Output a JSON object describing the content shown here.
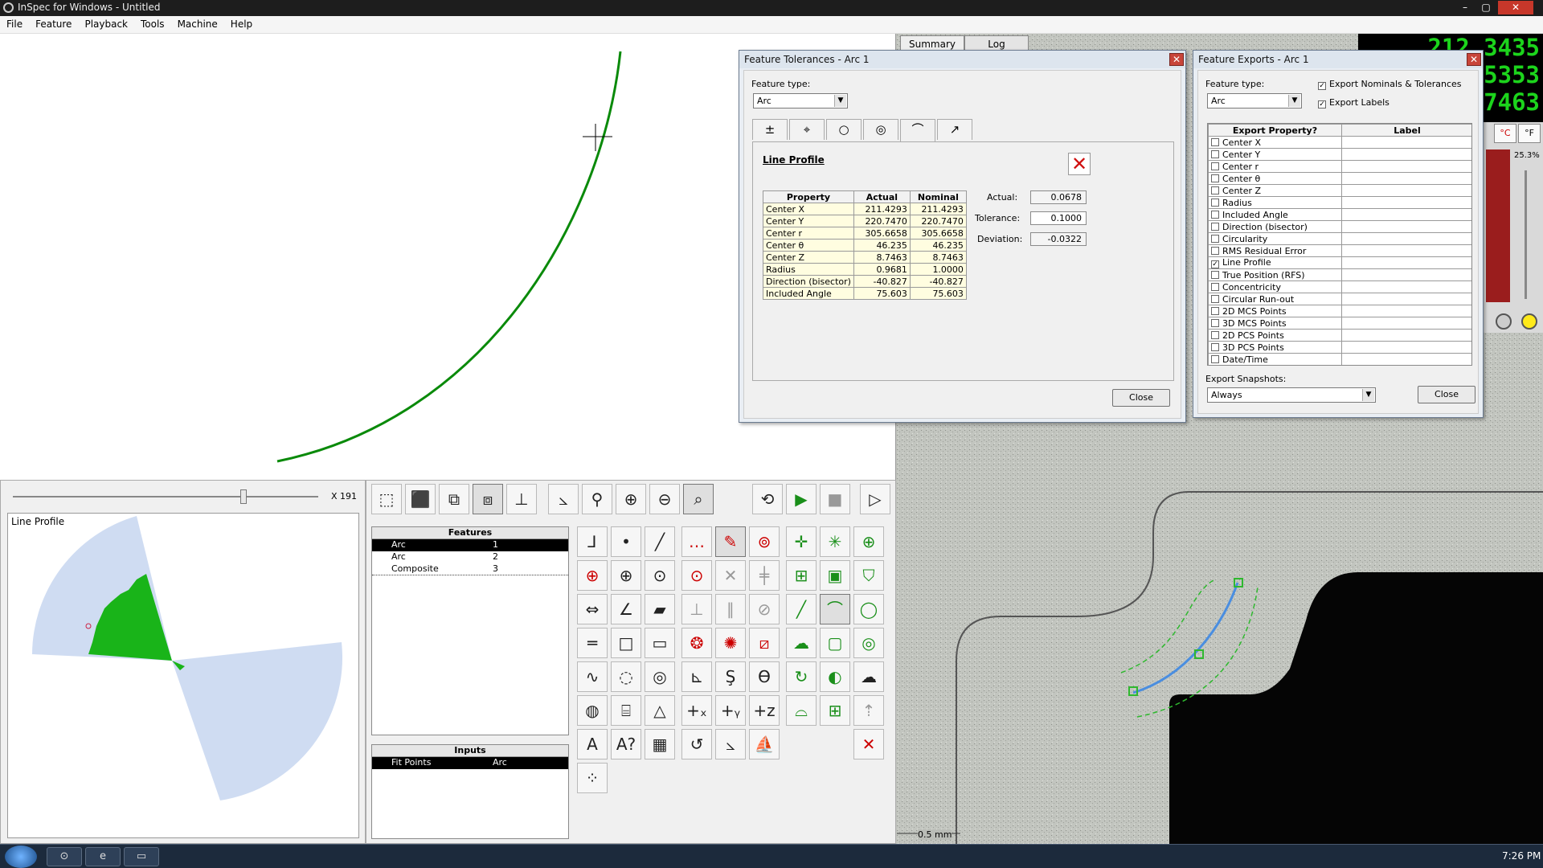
{
  "window": {
    "title": "InSpec for Windows - Untitled",
    "minimize": "–",
    "maximize": "▢",
    "close": "✕"
  },
  "menu": [
    "File",
    "Feature",
    "Playback",
    "Tools",
    "Machine",
    "Help"
  ],
  "profile_panel": {
    "title": "Line Profile",
    "zoom": "X 191"
  },
  "features_list": {
    "header": "Features",
    "rows": [
      {
        "label": "Arc",
        "num": "1"
      },
      {
        "label": "Arc",
        "num": "2"
      },
      {
        "label": "Composite",
        "num": "3"
      }
    ]
  },
  "inputs_list": {
    "header": "Inputs",
    "rows": [
      {
        "label": "Fit Points",
        "right": "Arc"
      }
    ]
  },
  "tolerances_dialog": {
    "title": "Feature Tolerances - Arc 1",
    "feature_type_label": "Feature type:",
    "feature_type_value": "Arc",
    "section_title": "Line Profile",
    "columns": [
      "Property",
      "Actual",
      "Nominal"
    ],
    "rows": [
      [
        "Center X",
        "211.4293",
        "211.4293"
      ],
      [
        "Center Y",
        "220.7470",
        "220.7470"
      ],
      [
        "Center r",
        "305.6658",
        "305.6658"
      ],
      [
        "Center θ",
        "46.235",
        "46.235"
      ],
      [
        "Center Z",
        "8.7463",
        "8.7463"
      ],
      [
        "Radius",
        "0.9681",
        "1.0000"
      ],
      [
        "Direction (bisector)",
        "-40.827",
        "-40.827"
      ],
      [
        "Included Angle",
        "75.603",
        "75.603"
      ]
    ],
    "actual_label": "Actual:",
    "actual_value": "0.0678",
    "tolerance_label": "Tolerance:",
    "tolerance_value": "0.1000",
    "deviation_label": "Deviation:",
    "deviation_value": "-0.0322",
    "close_label": "Close"
  },
  "exports_dialog": {
    "title": "Feature Exports - Arc 1",
    "feature_type_label": "Feature type:",
    "feature_type_value": "Arc",
    "export_nominals_label": "Export Nominals & Tolerances",
    "export_labels_label": "Export Labels",
    "columns": [
      "Export Property?",
      "Label"
    ],
    "properties": [
      {
        "name": "Center X",
        "checked": false
      },
      {
        "name": "Center Y",
        "checked": false
      },
      {
        "name": "Center r",
        "checked": false
      },
      {
        "name": "Center θ",
        "checked": false
      },
      {
        "name": "Center Z",
        "checked": false
      },
      {
        "name": "Radius",
        "checked": false
      },
      {
        "name": "Included Angle",
        "checked": false
      },
      {
        "name": "Direction (bisector)",
        "checked": false
      },
      {
        "name": "Circularity",
        "checked": false
      },
      {
        "name": "RMS Residual Error",
        "checked": false
      },
      {
        "name": "Line Profile",
        "checked": true
      },
      {
        "name": "True Position (RFS)",
        "checked": false
      },
      {
        "name": "Concentricity",
        "checked": false
      },
      {
        "name": "Circular Run-out",
        "checked": false
      },
      {
        "name": "2D MCS Points",
        "checked": false
      },
      {
        "name": "3D MCS Points",
        "checked": false
      },
      {
        "name": "2D PCS Points",
        "checked": false
      },
      {
        "name": "3D PCS Points",
        "checked": false
      },
      {
        "name": "Date/Time",
        "checked": false
      }
    ],
    "snapshots_label": "Export Snapshots:",
    "snapshots_value": "Always",
    "close_label": "Close"
  },
  "right_tabs": [
    "Summary",
    "Log"
  ],
  "led": [
    "212.3435",
    "5353",
    "7463"
  ],
  "units": {
    "c": "°C",
    "f": "°F",
    "percent": "25.3%"
  },
  "camera": {
    "scale": "0.5 mm"
  },
  "clock": "7:26 PM",
  "colors": {
    "green": "#0a8a0a",
    "dialog": "#e9eef4"
  }
}
